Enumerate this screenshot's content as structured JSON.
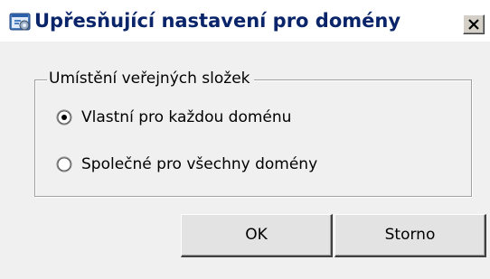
{
  "window": {
    "title": "Upřesňující nastavení pro domény"
  },
  "group": {
    "legend": "Umístění veřejných složek",
    "options": [
      {
        "label": "Vlastní pro každou doménu",
        "selected": true
      },
      {
        "label": "Společné pro všechny domény",
        "selected": false
      }
    ]
  },
  "buttons": {
    "ok_label": "OK",
    "cancel_label": "Storno"
  },
  "colors": {
    "title_text": "#0a246a",
    "dialog_background": "#f0f0f0",
    "button_face": "#e3e3e3"
  },
  "icons": {
    "title": "settings-window-icon",
    "close": "close-icon"
  }
}
